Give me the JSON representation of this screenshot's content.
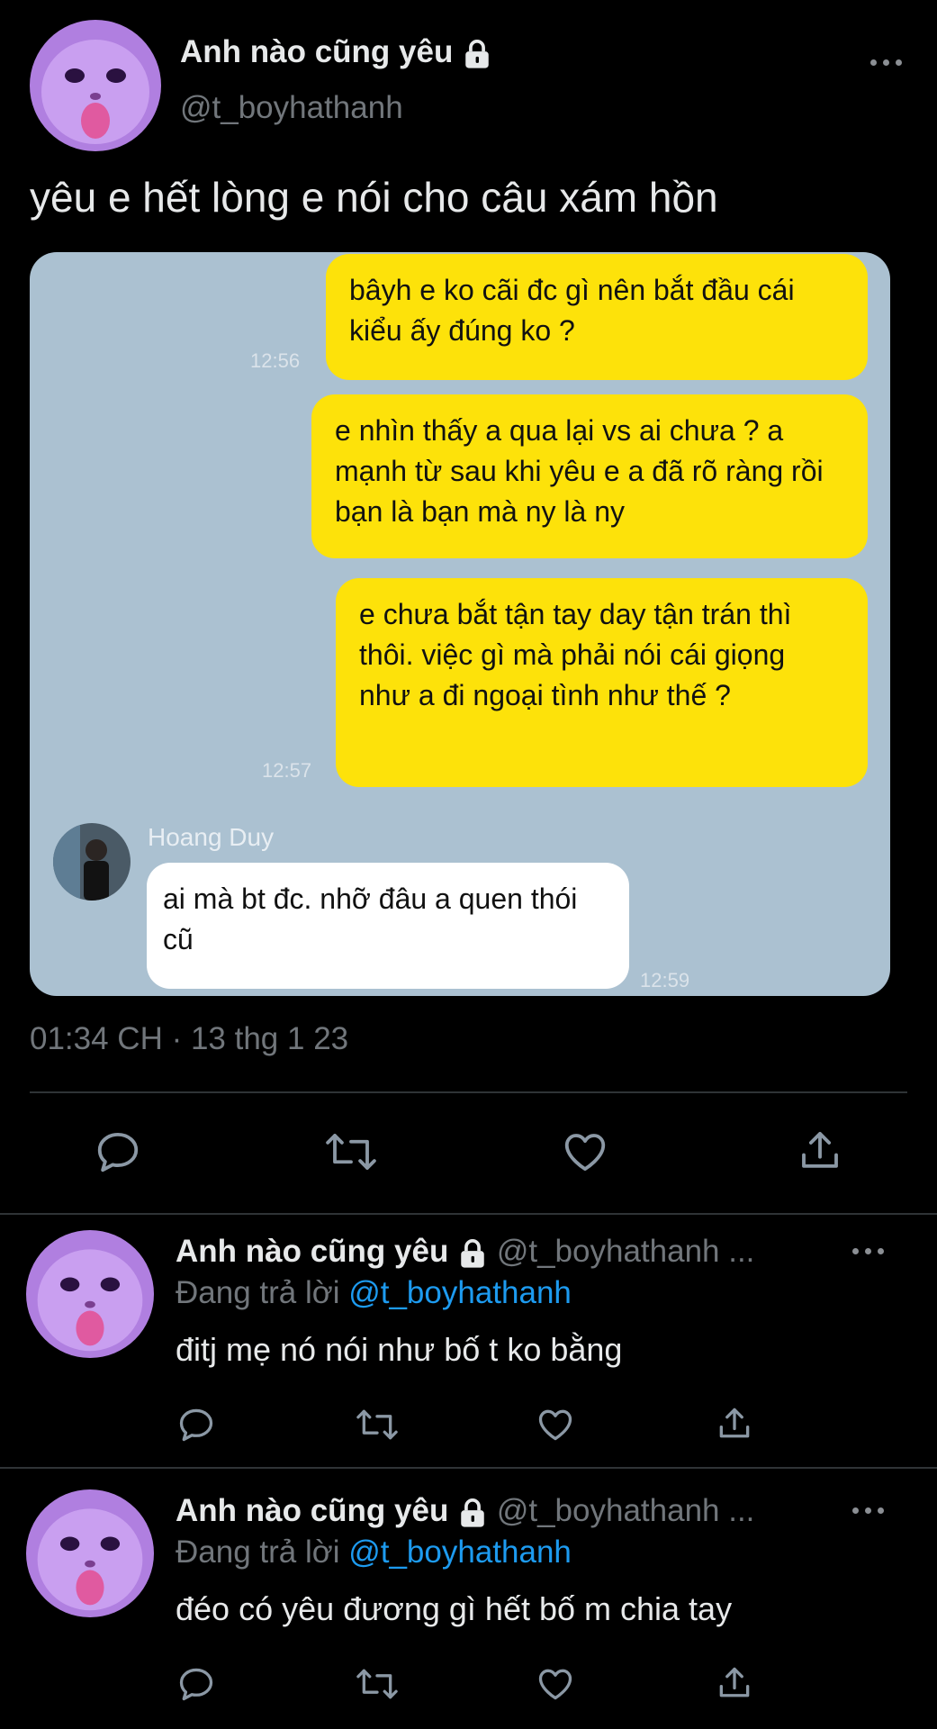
{
  "main_tweet": {
    "display_name": "Anh nào cũng yêu",
    "handle": "@t_boyhathanh",
    "text": "yêu e hết lòng e nói cho câu xám hồn",
    "timestamp": "01:34 CH · 13 thg 1 23"
  },
  "chat": {
    "messages": [
      {
        "text": "bâyh e ko cãi đc gì nên bắt đầu cái kiểu ấy đúng ko ?",
        "time": "12:56"
      },
      {
        "text": "e nhìn thấy a qua lại vs ai chưa ? a mạnh từ sau khi yêu e a đã rõ ràng rồi bạn là bạn mà ny là ny",
        "time": ""
      },
      {
        "text": "e chưa bắt tận tay day tận trán thì thôi. việc gì mà phải nói cái giọng như a đi ngoại tình như thế ?",
        "time": "12:57"
      }
    ],
    "reply": {
      "sender": "Hoang Duy",
      "text": "ai mà bt đc. nhỡ đâu a quen thói cũ",
      "time": "12:59"
    }
  },
  "replies": [
    {
      "display_name": "Anh nào cũng yêu",
      "handle": "@t_boyhathanh ...",
      "replying_label": "Đang trả lời",
      "replying_to": "@t_boyhathanh",
      "text": "đitj mẹ nó nói như bố t ko bằng"
    },
    {
      "display_name": "Anh nào cũng yêu",
      "handle": "@t_boyhathanh ...",
      "replying_label": "Đang trả lời",
      "replying_to": "@t_boyhathanh",
      "text": "đéo có yêu đương gì hết bố m chia tay"
    }
  ],
  "colors": {
    "background": "#000000",
    "chat_background": "#abc1d1",
    "outgoing_bubble": "#fde20a",
    "link": "#1d9bf0"
  },
  "icons": [
    "reply-icon",
    "retweet-icon",
    "like-icon",
    "share-icon",
    "lock-icon",
    "more-icon"
  ]
}
